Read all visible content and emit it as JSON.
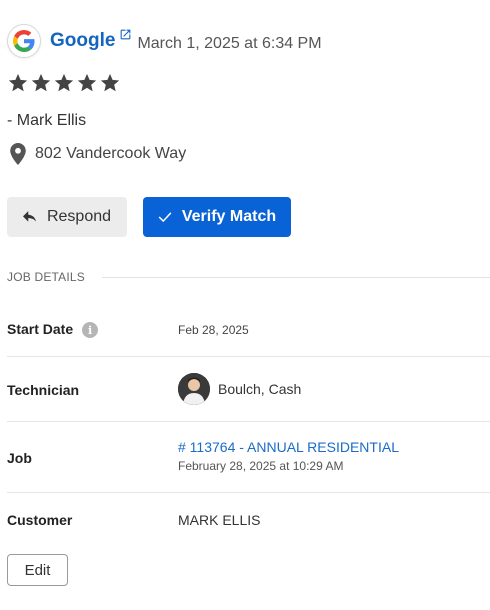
{
  "review": {
    "source": "Google",
    "date": "March 1, 2025 at 6:34 PM",
    "rating": 5,
    "rating_max": 5,
    "reviewer": "- Mark Ellis",
    "address": "802 Vandercook Way"
  },
  "actions": {
    "respond_label": "Respond",
    "verify_label": "Verify Match"
  },
  "job_details": {
    "section_title": "JOB DETAILS",
    "start_date": {
      "label": "Start Date",
      "value": "Feb 28, 2025"
    },
    "technician": {
      "label": "Technician",
      "value": "Boulch, Cash"
    },
    "job": {
      "label": "Job",
      "link": "# 113764 - ANNUAL RESIDENTIAL",
      "date": "February 28, 2025 at 10:29 AM"
    },
    "customer": {
      "label": "Customer",
      "value": "MARK ELLIS"
    },
    "edit_label": "Edit"
  },
  "colors": {
    "brand_link": "#1565c0",
    "primary_button": "#0a63d6",
    "star": "#444444"
  },
  "icons": [
    "google-logo",
    "external-link-icon",
    "star-icon",
    "location-pin-icon",
    "reply-icon",
    "check-icon",
    "info-icon",
    "avatar"
  ]
}
